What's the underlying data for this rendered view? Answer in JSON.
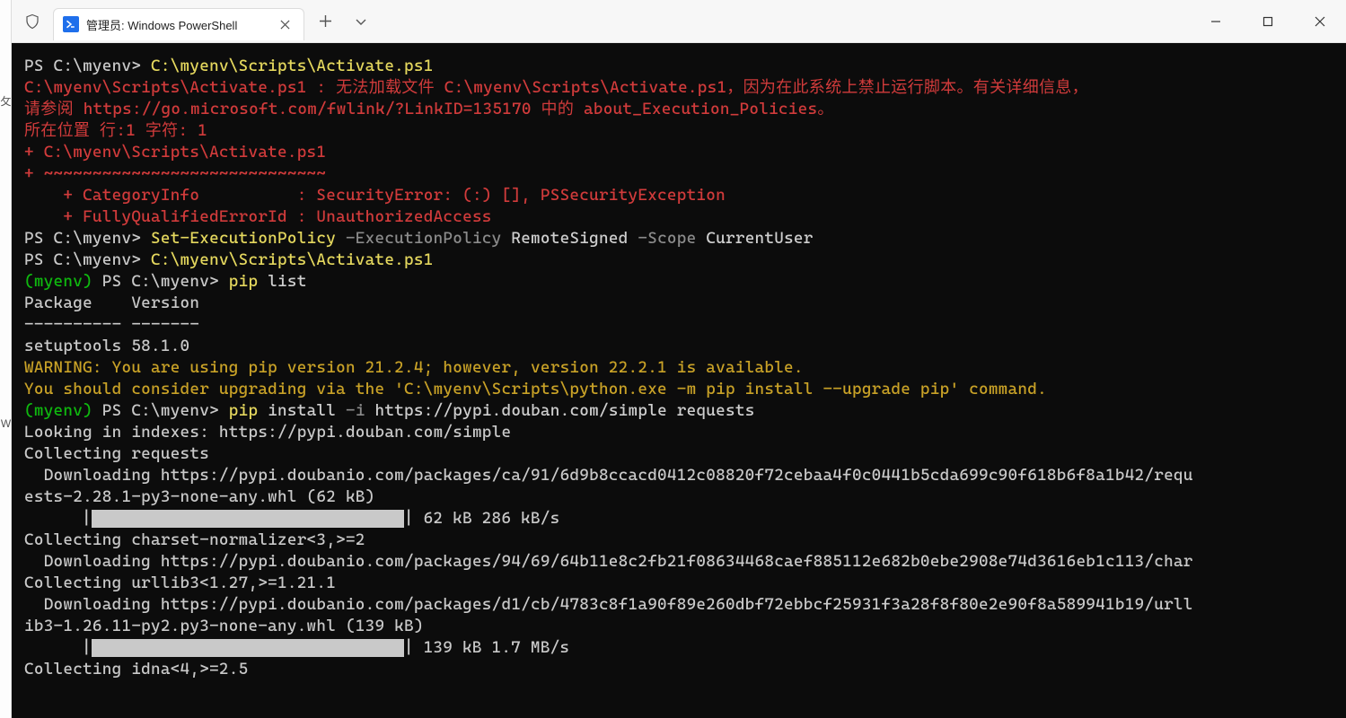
{
  "titlebar": {
    "tab_title": "管理员: Windows PowerShell"
  },
  "term": {
    "l1_prompt": "PS C:\\myenv> ",
    "l1_cmd": "C:\\myenv\\Scripts\\Activate.ps1",
    "err1": "C:\\myenv\\Scripts\\Activate.ps1 : 无法加载文件 C:\\myenv\\Scripts\\Activate.ps1，因为在此系统上禁止运行脚本。有关详细信息，",
    "err2": "请参阅 https://go.microsoft.com/fwlink/?LinkID=135170 中的 about_Execution_Policies。",
    "err3": "所在位置 行:1 字符: 1",
    "err4": "+ C:\\myenv\\Scripts\\Activate.ps1",
    "err5": "+ ~~~~~~~~~~~~~~~~~~~~~~~~~~~~~",
    "err6": "    + CategoryInfo          : SecurityError: (:) [], PSSecurityException",
    "err7": "    + FullyQualifiedErrorId : UnauthorizedAccess",
    "l2_prompt": "PS C:\\myenv> ",
    "l2_cmd": "Set-ExecutionPolicy ",
    "l2_param1": "-ExecutionPolicy ",
    "l2_val1": "RemoteSigned ",
    "l2_param2": "-Scope ",
    "l2_val2": "CurrentUser",
    "l3_prompt": "PS C:\\myenv> ",
    "l3_cmd": "C:\\myenv\\Scripts\\Activate.ps1",
    "venv": "(myenv) ",
    "l4_prompt": "PS C:\\myenv> ",
    "l4_cmd": "pip ",
    "l4_arg": "list",
    "pkg_hdr": "Package    Version",
    "pkg_sep": "---------- -------",
    "pkg_row": "setuptools 58.1.0",
    "warn1": "WARNING: You are using pip version 21.2.4; however, version 22.2.1 is available.",
    "warn2": "You should consider upgrading via the 'C:\\myenv\\Scripts\\python.exe -m pip install --upgrade pip' command.",
    "l5_prompt": "PS C:\\myenv> ",
    "l5_cmd": "pip ",
    "l5_arg1": "install ",
    "l5_flag": "-i ",
    "l5_arg2": "https://pypi.douban.com/simple requests",
    "out1": "Looking in indexes: https://pypi.douban.com/simple",
    "out2": "Collecting requests",
    "out3": "  Downloading https://pypi.doubanio.com/packages/ca/91/6d9b8ccacd0412c08820f72cebaa4f0c0441b5cda699c90f618b6f8a1b42/requ",
    "out3b": "ests-2.28.1-py3-none-any.whl (62 kB)",
    "prog1": " 62 kB 286 kB/s",
    "out4": "Collecting charset-normalizer<3,>=2",
    "out5": "  Downloading https://pypi.doubanio.com/packages/94/69/64b11e8c2fb21f08634468caef885112e682b0ebe2908e74d3616eb1c113/char",
    "out6": "Collecting urllib3<1.27,>=1.21.1",
    "out7": "  Downloading https://pypi.doubanio.com/packages/d1/cb/4783c8f1a90f89e260dbf72ebbcf25931f3a28f8f80e2e90f8a589941b19/urll",
    "out7b": "ib3-1.26.11-py2.py3-none-any.whl (139 kB)",
    "prog2": " 139 kB 1.7 MB/s",
    "out8": "Collecting idna<4,>=2.5"
  }
}
